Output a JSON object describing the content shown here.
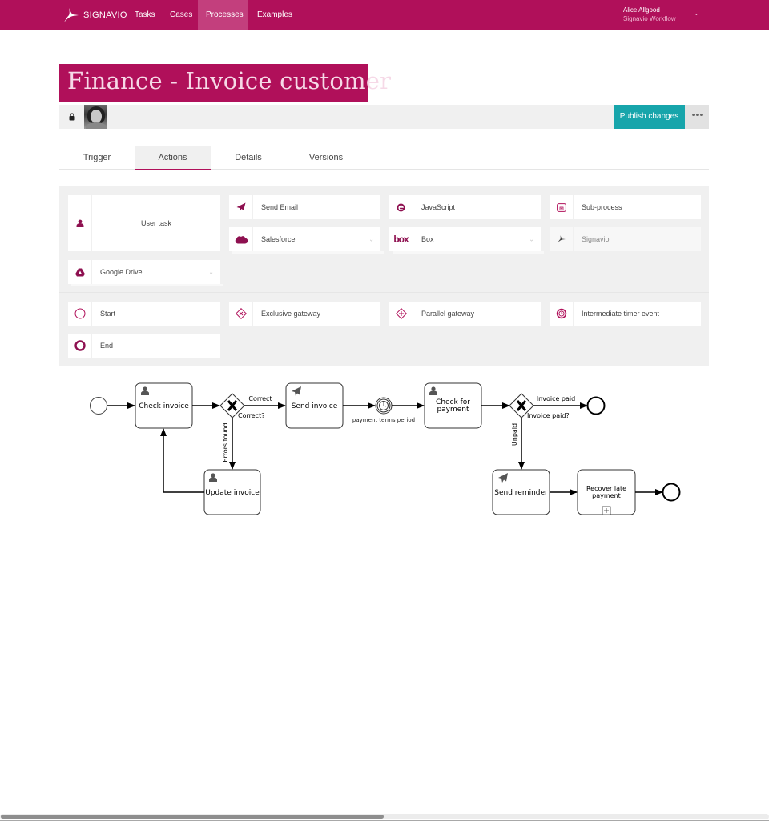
{
  "nav": {
    "brand": "SIGNAVIO",
    "items": [
      {
        "label": "Tasks",
        "active": false
      },
      {
        "label": "Cases",
        "active": false
      },
      {
        "label": "Processes",
        "active": true
      },
      {
        "label": "Examples",
        "active": false
      }
    ],
    "user": {
      "name": "Alice Allgood",
      "org": "Signavio Workflow",
      "menu_icon": "chevron-down-icon"
    }
  },
  "colors": {
    "brand": "#b0105a",
    "accent": "#17a5ab",
    "nav_active": "#c33f7d",
    "icon": "#8e1050"
  },
  "process": {
    "title": "Finance - Invoice customer",
    "locked_icon": "lock-icon",
    "publish_label": "Publish changes",
    "more_label": "•••"
  },
  "tabs": [
    {
      "label": "Trigger",
      "active": false
    },
    {
      "label": "Actions",
      "active": true
    },
    {
      "label": "Details",
      "active": false
    },
    {
      "label": "Versions",
      "active": false
    }
  ],
  "palette": {
    "actions": [
      {
        "label": "User task",
        "icon": "user-icon"
      },
      {
        "label": "Send Email",
        "icon": "paper-plane-icon"
      },
      {
        "label": "JavaScript",
        "icon": "javascript-icon"
      },
      {
        "label": "Sub-process",
        "icon": "subprocess-icon"
      },
      {
        "label": "Salesforce",
        "icon": "salesforce-icon",
        "dropdown": true
      },
      {
        "label": "Box",
        "icon": "box-icon",
        "dropdown": true
      },
      {
        "label": "Signavio",
        "icon": "signavio-icon",
        "disabled": true
      },
      {
        "label": "Google Drive",
        "icon": "google-drive-icon",
        "dropdown": true
      }
    ],
    "events": [
      {
        "label": "Start",
        "icon": "start-event-icon"
      },
      {
        "label": "Exclusive gateway",
        "icon": "exclusive-gateway-icon"
      },
      {
        "label": "Parallel gateway",
        "icon": "parallel-gateway-icon"
      },
      {
        "label": "Intermediate timer event",
        "icon": "timer-event-icon"
      },
      {
        "label": "End",
        "icon": "end-event-icon"
      }
    ],
    "caret": "⌄"
  },
  "diagram": {
    "tasks": {
      "check_invoice": "Check invoice",
      "send_invoice": "Send invoice",
      "check_payment_1": "Check for",
      "check_payment_2": "payment",
      "update_invoice": "Update invoice",
      "send_reminder": "Send reminder",
      "recover_1": "Recover late",
      "recover_2": "payment"
    },
    "gateways": {
      "correct": "Correct?",
      "paid": "Invoice paid?"
    },
    "flows": {
      "correct": "Correct",
      "errors_found": "Errors found",
      "invoice_paid": "Invoice paid",
      "unpaid": "Unpaid"
    },
    "timer": "payment terms period"
  },
  "scrollbar": {
    "horizontal_position": 0,
    "visible_fraction": 0.5
  }
}
